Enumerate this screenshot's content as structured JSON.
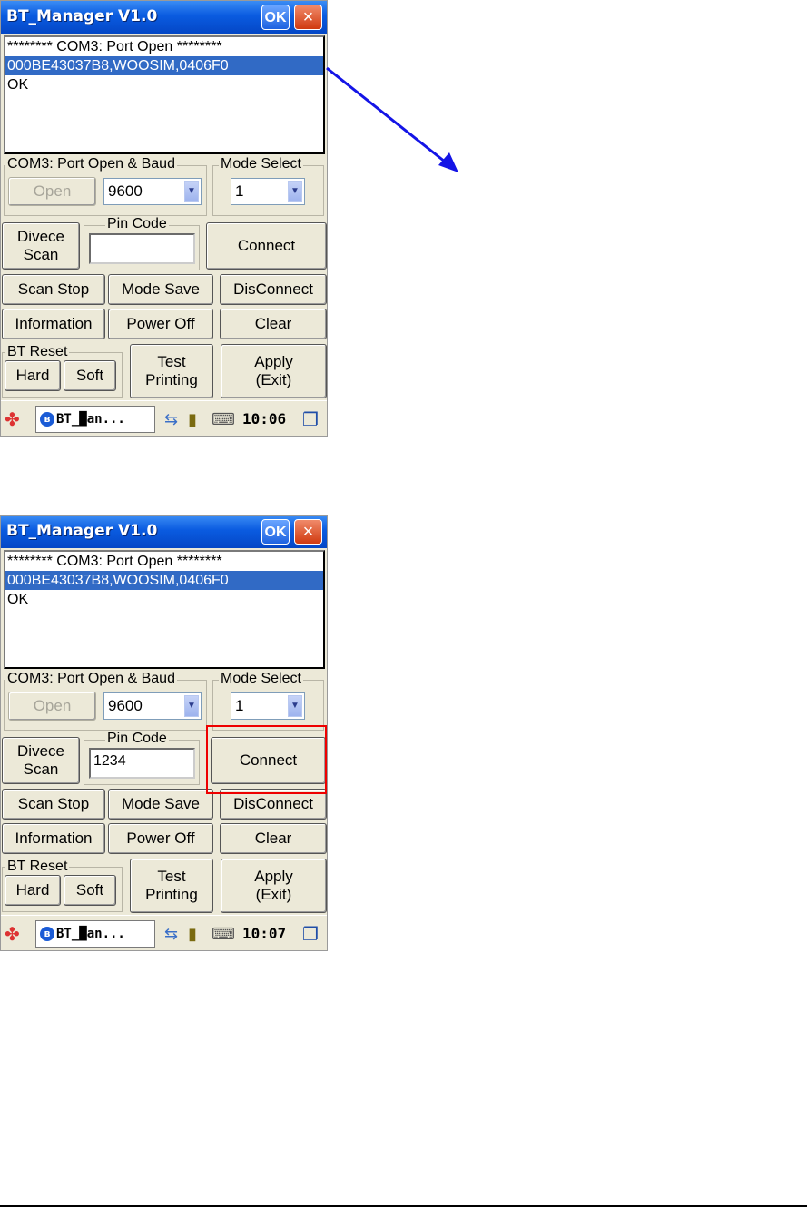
{
  "screens": [
    {
      "title": "BT_Manager V1.0",
      "ok_label": "OK",
      "close_label": "×",
      "log_lines": [
        "******** COM3: Port Open ********",
        "000BE43037B8,WOOSIM,0406F0",
        "OK"
      ],
      "port_group_label": "COM3: Port Open & Baud",
      "open_label": "Open",
      "baud_value": "9600",
      "mode_group_label": "Mode Select",
      "mode_value": "1",
      "device_scan_label": "Divece\nScan",
      "pin_group_label": "Pin Code",
      "pin_value": "",
      "connect_label": "Connect",
      "scan_stop_label": "Scan Stop",
      "mode_save_label": "Mode Save",
      "disconnect_label": "DisConnect",
      "information_label": "Information",
      "power_off_label": "Power Off",
      "clear_label": "Clear",
      "bt_reset_label": "BT Reset",
      "hard_label": "Hard",
      "soft_label": "Soft",
      "test_printing_label": "Test\nPrinting",
      "apply_label": "Apply\n(Exit)",
      "taskbar_item": "BT_█an...",
      "clock": "10:06"
    },
    {
      "title": "BT_Manager V1.0",
      "ok_label": "OK",
      "close_label": "×",
      "log_lines": [
        "******** COM3: Port Open ********",
        "000BE43037B8,WOOSIM,0406F0",
        "OK"
      ],
      "port_group_label": "COM3: Port Open & Baud",
      "open_label": "Open",
      "baud_value": "9600",
      "mode_group_label": "Mode Select",
      "mode_value": "1",
      "device_scan_label": "Divece\nScan",
      "pin_group_label": "Pin Code",
      "pin_value": "1234",
      "connect_label": "Connect",
      "scan_stop_label": "Scan Stop",
      "mode_save_label": "Mode Save",
      "disconnect_label": "DisConnect",
      "information_label": "Information",
      "power_off_label": "Power Off",
      "clear_label": "Clear",
      "bt_reset_label": "BT Reset",
      "hard_label": "Hard",
      "soft_label": "Soft",
      "test_printing_label": "Test\nPrinting",
      "apply_label": "Apply\n(Exit)",
      "taskbar_item": "BT_█an...",
      "clock": "10:07"
    }
  ],
  "colors": {
    "title_bar": "#0a5be0",
    "selection": "#316ac5",
    "window_bg": "#ece9d8",
    "arrow": "#1414e6",
    "highlight": "#e00000"
  },
  "icons": [
    "windows-start-icon",
    "bluetooth-icon",
    "network-icon",
    "battery-icon",
    "keyboard-icon",
    "desktop-icon",
    "close-icon",
    "dropdown-arrow-icon"
  ]
}
